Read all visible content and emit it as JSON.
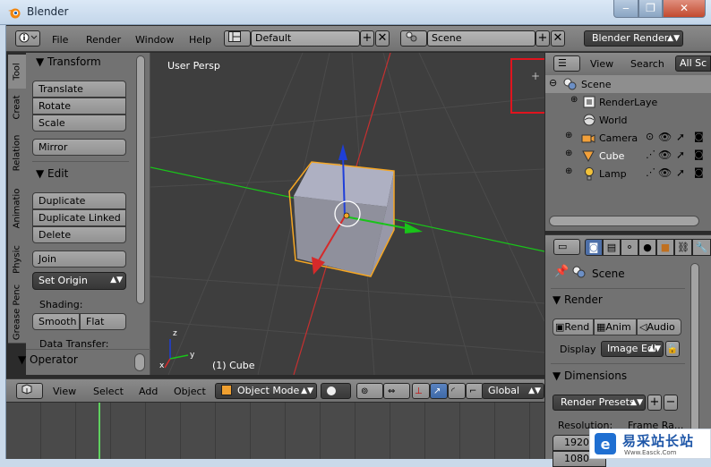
{
  "window": {
    "title": "Blender",
    "buttons": [
      "‒",
      "❐",
      "✕"
    ]
  },
  "header": {
    "editor_icon": "info-editor-icon",
    "menus": [
      "File",
      "Render",
      "Window",
      "Help"
    ],
    "screen_layout": "Default",
    "scene": "Scene",
    "render_engine": "Blender Render"
  },
  "tool_tabs": [
    "Tool",
    "Creat",
    "Relation",
    "Animatio",
    "Physic",
    "Grease Penc"
  ],
  "toolshelf": {
    "transform_title": "Transform",
    "transform_buttons": [
      "Translate",
      "Rotate",
      "Scale"
    ],
    "mirror": "Mirror",
    "edit_title": "Edit",
    "edit_buttons": [
      "Duplicate",
      "Duplicate Linked",
      "Delete"
    ],
    "join": "Join",
    "set_origin": "Set Origin",
    "shading_label": "Shading:",
    "smooth": "Smooth",
    "flat": "Flat",
    "data_transfer": "Data Transfer:",
    "operator_title": "Operator"
  },
  "viewport": {
    "view_name": "User Persp",
    "object_info": "(1) Cube",
    "axis_labels": {
      "x": "x",
      "y": "y",
      "z": "z"
    }
  },
  "viewport_header": {
    "menus": [
      "View",
      "Select",
      "Add",
      "Object"
    ],
    "mode": "Object Mode",
    "orientation": "Global"
  },
  "outliner": {
    "menus": [
      "View",
      "Search"
    ],
    "filter": "All Sc",
    "items": [
      {
        "label": "Scene",
        "icon": "scene-icon"
      },
      {
        "label": "RenderLaye",
        "icon": "render-layers-icon"
      },
      {
        "label": "World",
        "icon": "world-icon"
      },
      {
        "label": "Camera",
        "icon": "camera-icon"
      },
      {
        "label": "Cube",
        "icon": "mesh-icon"
      },
      {
        "label": "Lamp",
        "icon": "lamp-icon"
      }
    ]
  },
  "properties": {
    "context": "Scene",
    "render_panel": "Render",
    "render_buttons": [
      "Rend",
      "Anim",
      "Audio"
    ],
    "display_label": "Display",
    "display_value": "Image Edi",
    "dimensions_panel": "Dimensions",
    "presets": "Render Presets",
    "resolution_label": "Resolution:",
    "frame_rate_label": "Frame Ra...",
    "res_x": "1920",
    "res_y": "1080"
  },
  "watermark": {
    "brand": "易采站长站",
    "url": "Www.Easck.Com"
  },
  "colors": {
    "highlight_box": "#e0141e",
    "selection_outline": "#f5a623",
    "axis_x": "#d62a2a",
    "axis_y": "#19c419",
    "axis_z": "#1f3fd9"
  }
}
